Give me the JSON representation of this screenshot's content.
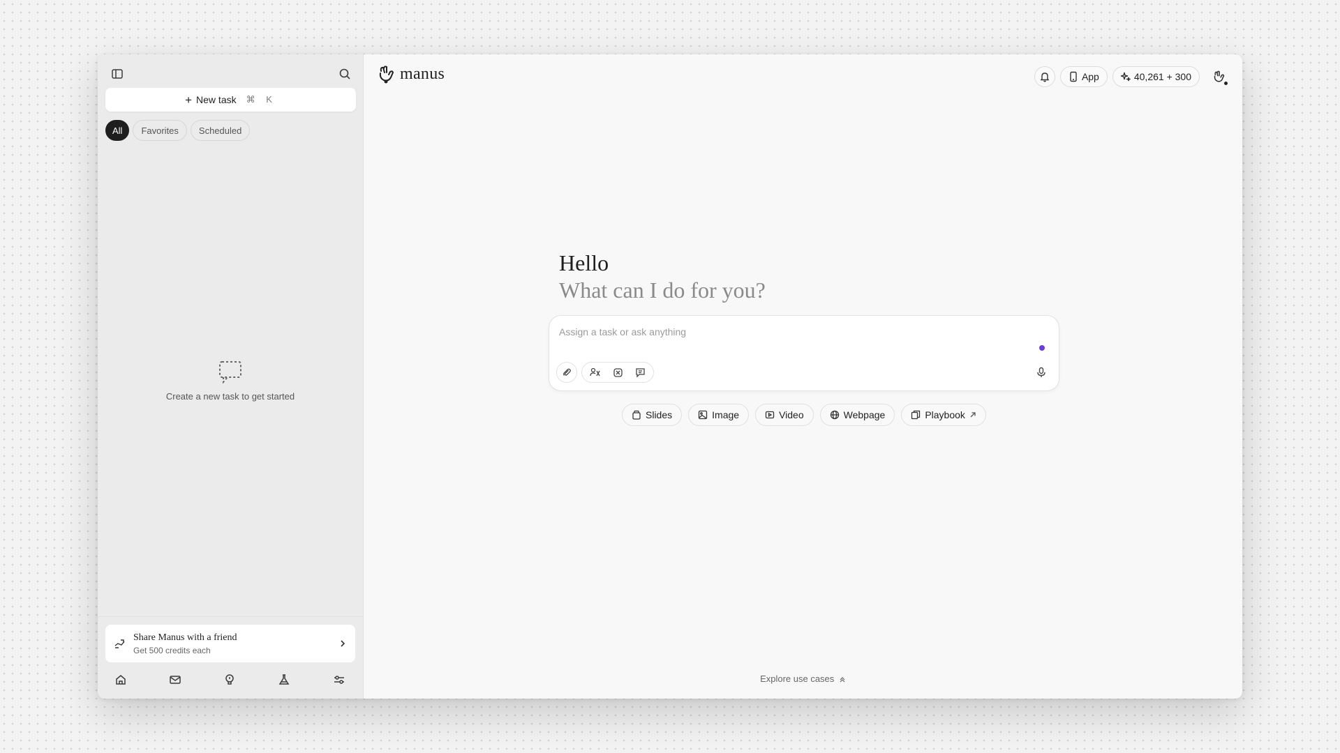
{
  "sidebar": {
    "new_task_label": "New task",
    "new_task_shortcut": "⌘ K",
    "filters": [
      {
        "label": "All",
        "active": true
      },
      {
        "label": "Favorites",
        "active": false
      },
      {
        "label": "Scheduled",
        "active": false
      }
    ],
    "empty_state": "Create a new task to get started",
    "share": {
      "title": "Share Manus with a friend",
      "subtitle": "Get 500 credits each"
    },
    "bottom_icons": [
      "home-icon",
      "mail-icon",
      "lightbulb-icon",
      "flask-icon",
      "settings-sliders-icon"
    ]
  },
  "header": {
    "brand": "manus",
    "app_label": "App",
    "credits": "40,261 + 300"
  },
  "main": {
    "greeting": "Hello",
    "subgreeting": "What can I do for you?",
    "input_placeholder": "Assign a task or ask anything",
    "quick_actions": [
      {
        "label": "Slides",
        "icon": "slides-icon"
      },
      {
        "label": "Image",
        "icon": "image-icon"
      },
      {
        "label": "Video",
        "icon": "video-icon"
      },
      {
        "label": "Webpage",
        "icon": "globe-icon"
      },
      {
        "label": "Playbook",
        "icon": "playbook-icon"
      }
    ],
    "explore_label": "Explore use cases"
  },
  "colors": {
    "accent_dot": "#6a3fd6",
    "active_chip": "#1e1e1e",
    "sidebar_bg": "#ebebeb",
    "main_bg": "#f8f8f8"
  }
}
